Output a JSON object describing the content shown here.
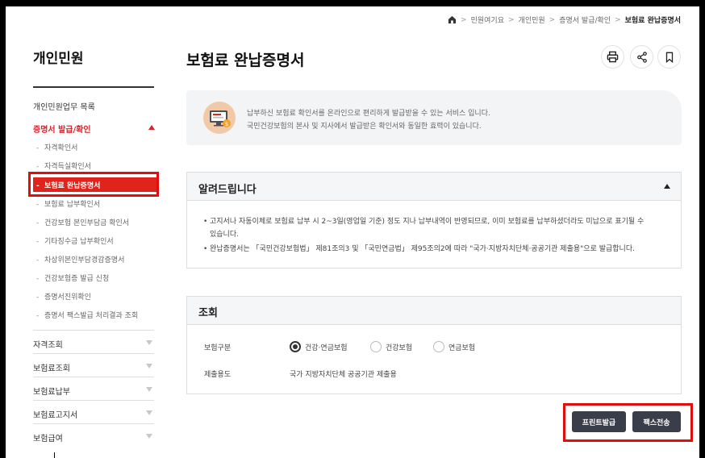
{
  "breadcrumb": [
    "민원여기요",
    "개인민원",
    "증명서 발급/확인",
    "보험료 완납증명서"
  ],
  "sidebar": {
    "title": "개인민원",
    "top_item": "개인민원업무 목록",
    "active_group": "증명서 발급/확인",
    "sub_items": [
      "자격확인서",
      "자격득실확인서",
      "보험료 완납증명서",
      "보험료 납부확인서",
      "건강보험 본인부담금 확인서",
      "기타징수금 납부확인서",
      "차상위본인부담경감증명서",
      "건강보험증 발급 신청",
      "증명서진위확인",
      "증명서 팩스발급 처리결과 조회"
    ],
    "active_sub_index": 2,
    "groups": [
      "자격조회",
      "보험료조회",
      "보험료납부",
      "보험료고지서",
      "보험급여"
    ]
  },
  "page": {
    "title": "보험료 완납증명서",
    "tools": [
      "print-icon",
      "share-icon",
      "bookmark-icon"
    ]
  },
  "intro": {
    "line1": "납부하신 보험료 확인서를 온라인으로 편리하게 발급받을 수 있는 서비스 입니다.",
    "line2": "국민건강보험의 본사 및 지사에서 발급받은 확인서와 동일한 효력이 있습니다."
  },
  "notice": {
    "title": "알려드립니다",
    "bullets": [
      "고지서나 자동이체로 보험료 납부 시 2~3일(영업일 기준) 정도 지나 납부내역이 반영되므로, 이미 보험료를 납부하셨더라도 미납으로 표기될 수",
      "있습니다.",
      "완납증명서는 「국민건강보험법」 제81조의3 및 「국민연금법」 제95조의2에 따라 \"국가·지방자치단체·공공기관 제출용\"으로 발급합니다."
    ]
  },
  "lookup": {
    "title": "조회",
    "type_label": "보험구분",
    "options": [
      "건강·연금보험",
      "건강보험",
      "연금보험"
    ],
    "selected_index": 0,
    "purpose_label": "제출용도",
    "purpose_value": "국가 지방자치단체 공공기관 제출용"
  },
  "actions": {
    "print": "프린트발급",
    "fax": "팩스전송"
  },
  "colors": {
    "accent_red": "#e0231b",
    "button_dark": "#3a3e4a"
  }
}
